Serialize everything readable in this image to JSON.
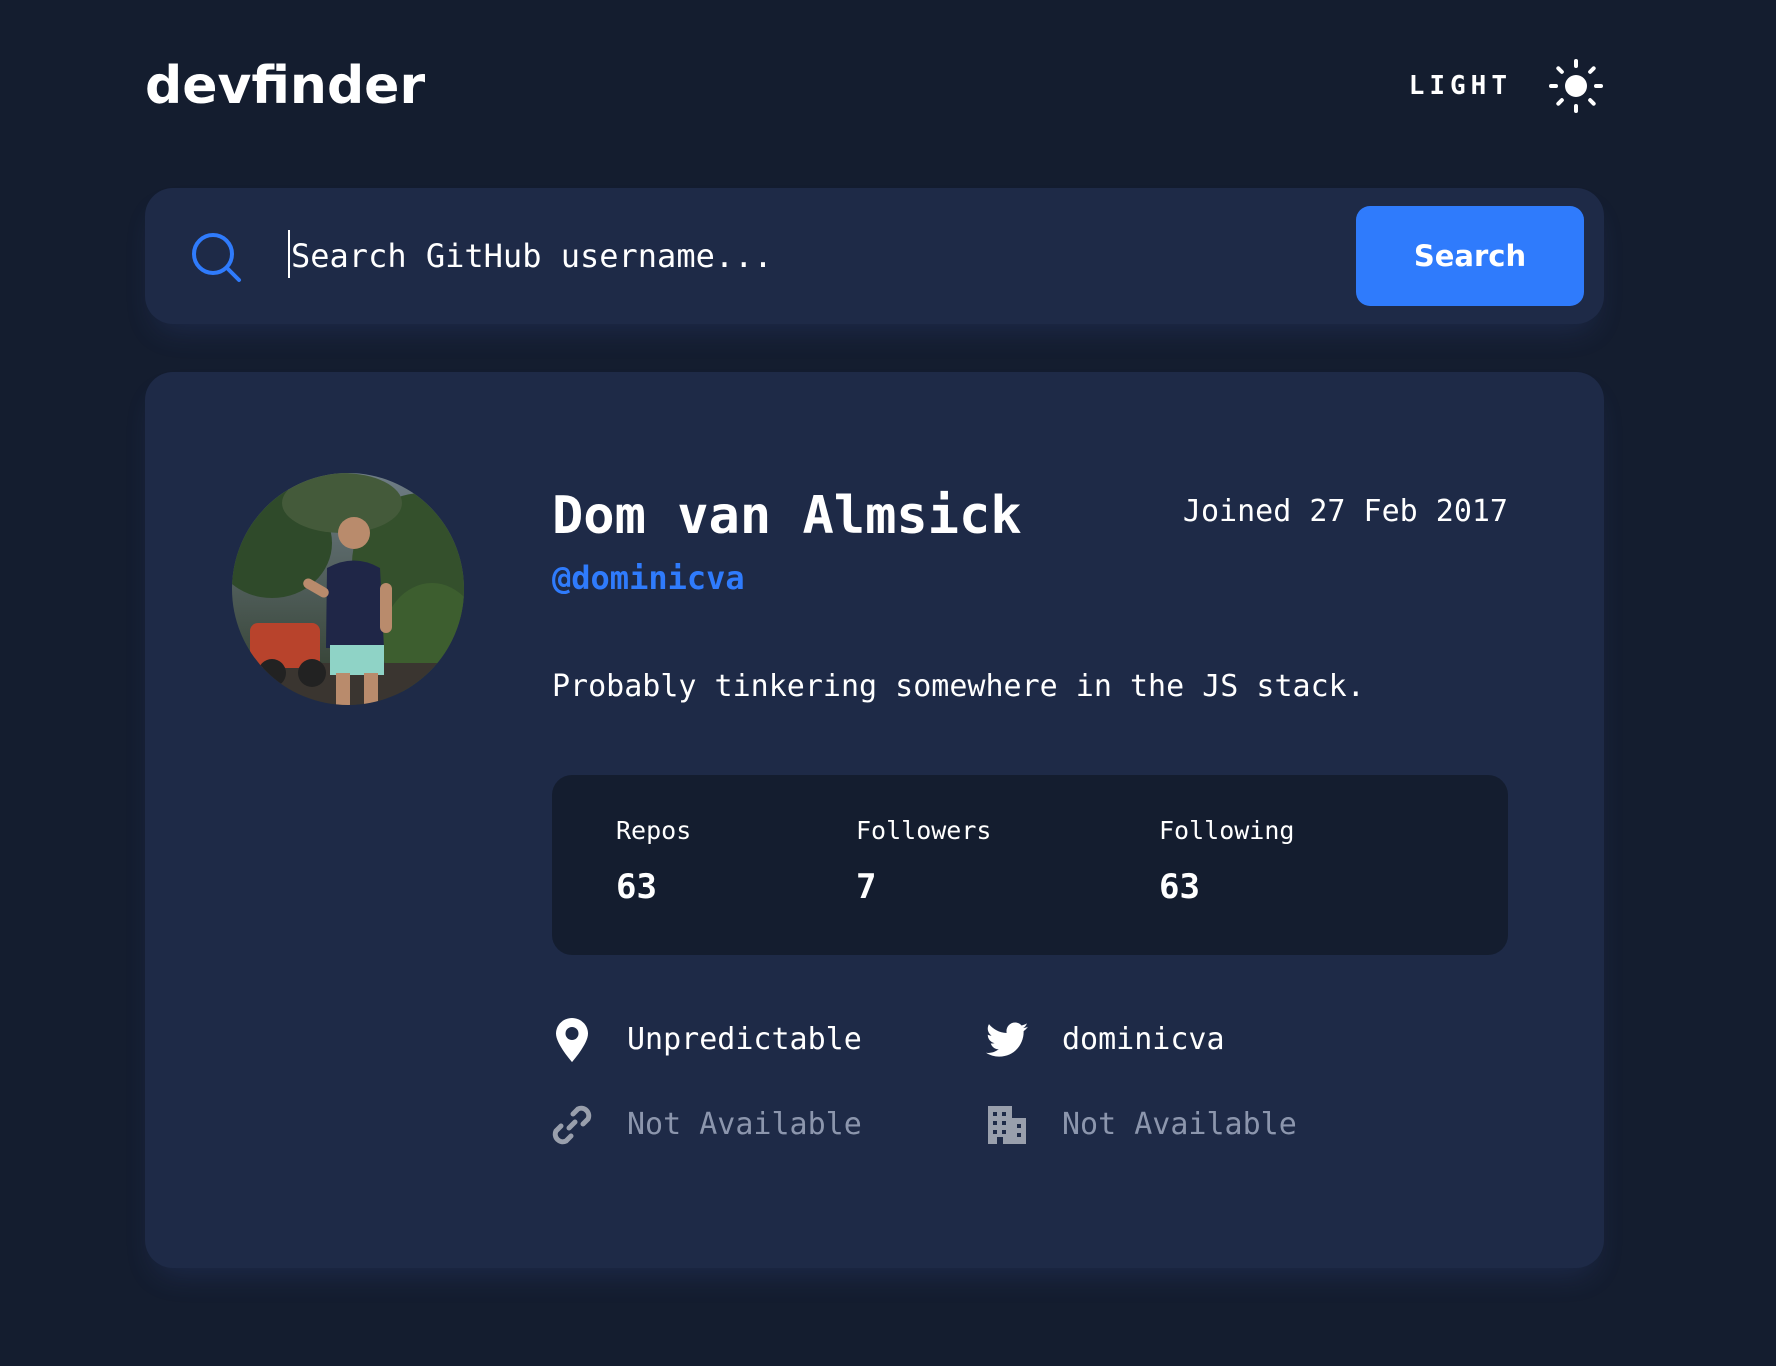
{
  "header": {
    "logo": "devfinder",
    "theme_label": "LIGHT",
    "theme_icon": "sun-icon"
  },
  "search": {
    "placeholder": "Search GitHub username...",
    "value": "",
    "button_label": "Search",
    "icon": "search-icon"
  },
  "profile": {
    "name": "Dom van Almsick",
    "joined": "Joined 27 Feb 2017",
    "handle": "@dominicva",
    "bio": "Probably tinkering somewhere in the JS stack.",
    "avatar": "avatar-photo"
  },
  "stats": {
    "repos": {
      "label": "Repos",
      "value": "63"
    },
    "followers": {
      "label": "Followers",
      "value": "7"
    },
    "following": {
      "label": "Following",
      "value": "63"
    }
  },
  "links": {
    "location": {
      "text": "Unpredictable",
      "icon": "location-pin-icon",
      "available": true
    },
    "twitter": {
      "text": "dominicva",
      "icon": "twitter-icon",
      "available": true
    },
    "website": {
      "text": "Not Available",
      "icon": "link-icon",
      "available": false
    },
    "company": {
      "text": "Not Available",
      "icon": "building-icon",
      "available": false
    }
  },
  "colors": {
    "background": "#141D2F",
    "card": "#1E2A47",
    "accent": "#2F7BFC",
    "text": "#FFFFFF",
    "muted": "#8C96AD"
  }
}
